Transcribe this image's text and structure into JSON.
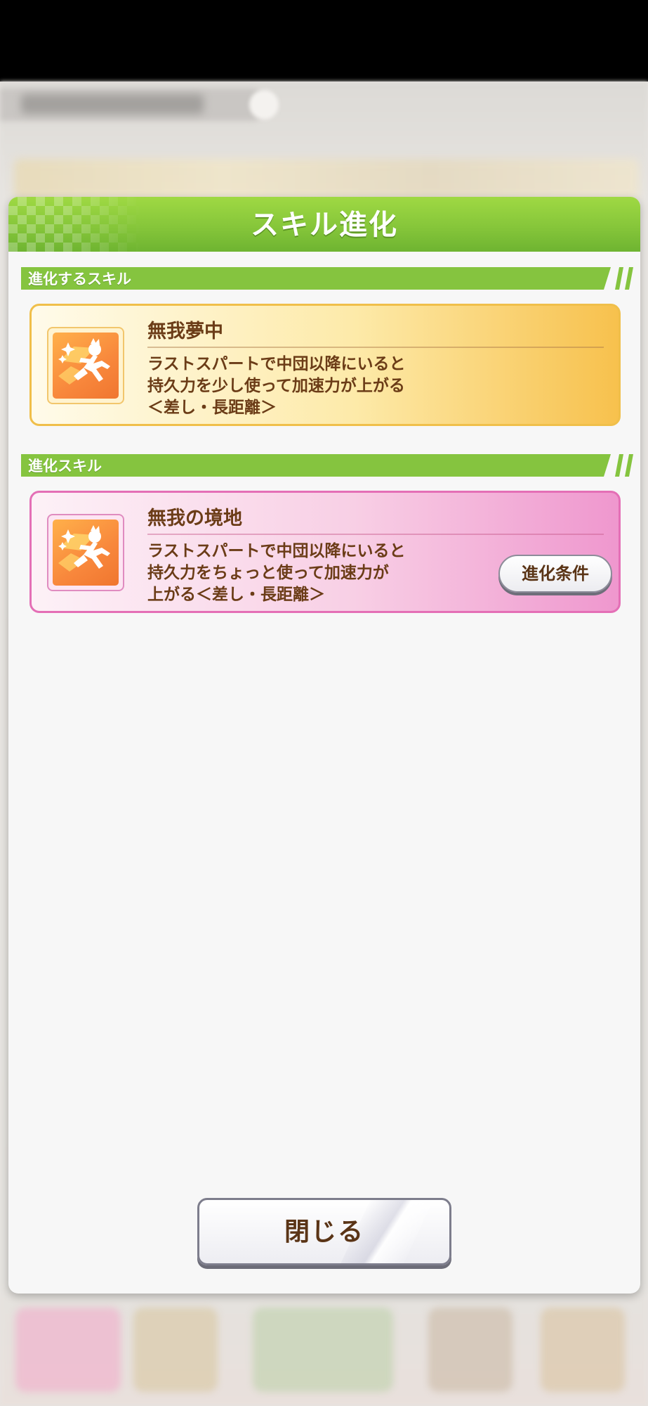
{
  "dialog": {
    "title": "スキル進化",
    "close_label": "閉じる"
  },
  "sections": [
    {
      "label": "進化するスキル",
      "skill": {
        "name": "無我夢中",
        "icon": "runner-speed-icon",
        "description_lines": [
          "ラストスパートで中団以降にいると",
          "持久力を少し使って加速力が上がる",
          "＜差し・長距離＞"
        ]
      }
    },
    {
      "label": "進化スキル",
      "skill": {
        "name": "無我の境地",
        "icon": "runner-speed-icon",
        "description_lines": [
          "ラストスパートで中団以降にいると",
          "持久力をちょっと使って加速力が",
          "上がる＜差し・長距離＞"
        ],
        "button_label": "進化条件"
      }
    }
  ],
  "colors": {
    "header_green": "#86c63a",
    "gold_card_border": "#f0bf4a",
    "pink_card_border": "#e46fb6",
    "text_brown": "#6b3c17"
  }
}
